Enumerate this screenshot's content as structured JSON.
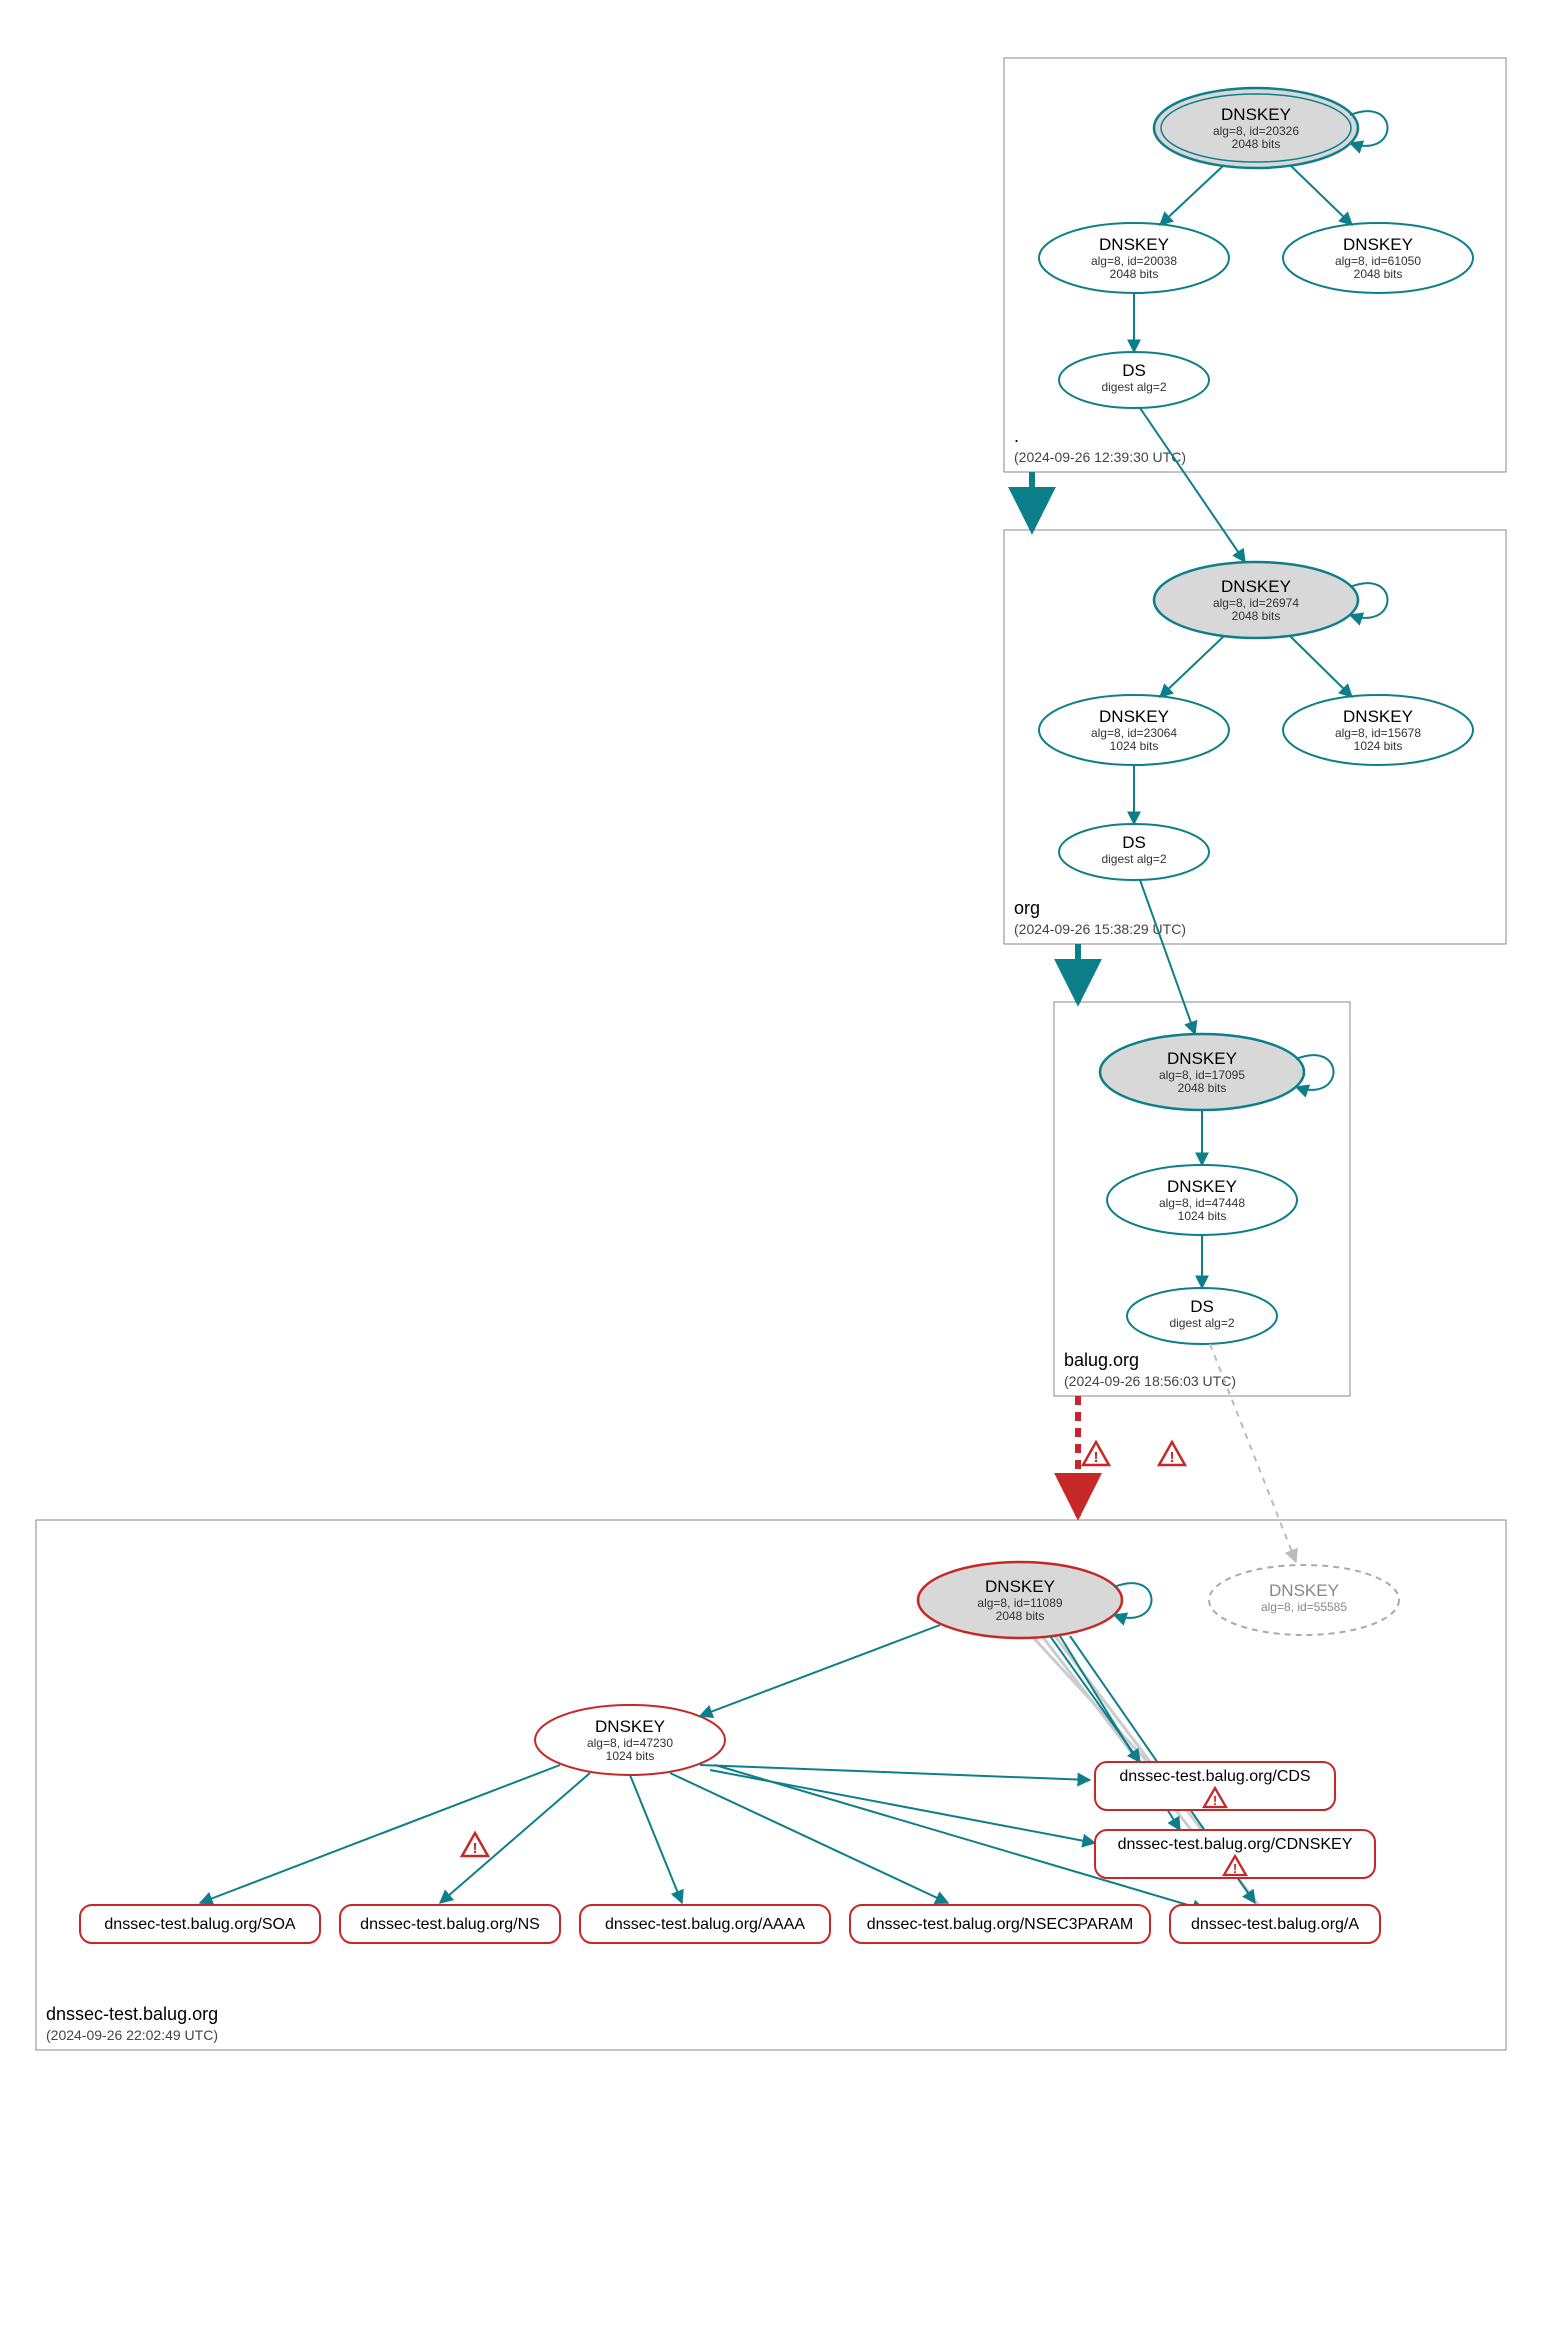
{
  "zones": {
    "root": {
      "label": ".",
      "ts": "(2024-09-26 12:39:30 UTC)"
    },
    "org": {
      "label": "org",
      "ts": "(2024-09-26 15:38:29 UTC)"
    },
    "balug": {
      "label": "balug.org",
      "ts": "(2024-09-26 18:56:03 UTC)"
    },
    "dnssec": {
      "label": "dnssec-test.balug.org",
      "ts": "(2024-09-26 22:02:49 UTC)"
    }
  },
  "nodes": {
    "root_ksk": {
      "t": "DNSKEY",
      "l2": "alg=8, id=20326",
      "l3": "2048 bits"
    },
    "root_zsk1": {
      "t": "DNSKEY",
      "l2": "alg=8, id=20038",
      "l3": "2048 bits"
    },
    "root_zsk2": {
      "t": "DNSKEY",
      "l2": "alg=8, id=61050",
      "l3": "2048 bits"
    },
    "root_ds": {
      "t": "DS",
      "l2": "digest alg=2",
      "l3": ""
    },
    "org_ksk": {
      "t": "DNSKEY",
      "l2": "alg=8, id=26974",
      "l3": "2048 bits"
    },
    "org_zsk1": {
      "t": "DNSKEY",
      "l2": "alg=8, id=23064",
      "l3": "1024 bits"
    },
    "org_zsk2": {
      "t": "DNSKEY",
      "l2": "alg=8, id=15678",
      "l3": "1024 bits"
    },
    "org_ds": {
      "t": "DS",
      "l2": "digest alg=2",
      "l3": ""
    },
    "balug_ksk": {
      "t": "DNSKEY",
      "l2": "alg=8, id=17095",
      "l3": "2048 bits"
    },
    "balug_zsk": {
      "t": "DNSKEY",
      "l2": "alg=8, id=47448",
      "l3": "1024 bits"
    },
    "balug_ds": {
      "t": "DS",
      "l2": "digest alg=2",
      "l3": ""
    },
    "dt_ksk": {
      "t": "DNSKEY",
      "l2": "alg=8, id=11089",
      "l3": "2048 bits"
    },
    "dt_missing": {
      "t": "DNSKEY",
      "l2": "alg=8, id=55585",
      "l3": ""
    },
    "dt_zsk": {
      "t": "DNSKEY",
      "l2": "alg=8, id=47230",
      "l3": "1024 bits"
    }
  },
  "rrsets": {
    "soa": "dnssec-test.balug.org/SOA",
    "ns": "dnssec-test.balug.org/NS",
    "aaaa": "dnssec-test.balug.org/AAAA",
    "nsec3": "dnssec-test.balug.org/NSEC3PARAM",
    "a": "dnssec-test.balug.org/A",
    "cds": "dnssec-test.balug.org/CDS",
    "cdnsk": "dnssec-test.balug.org/CDNSKEY"
  }
}
